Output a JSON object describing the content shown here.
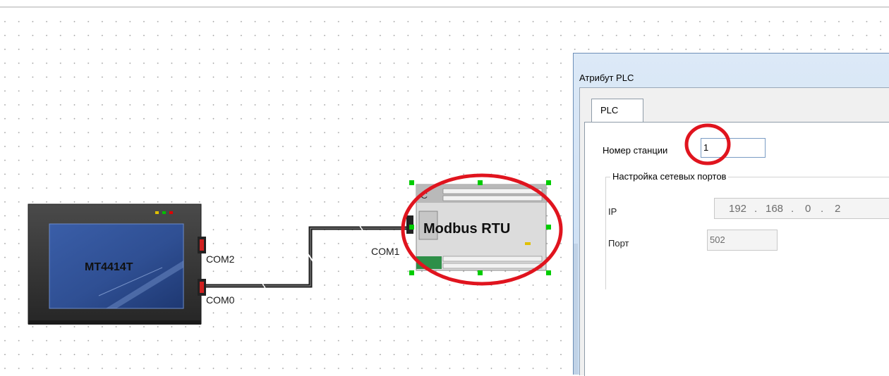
{
  "canvas": {
    "hmi_label": "MT4414T",
    "hmi_ports": [
      "COM2",
      "COM0"
    ],
    "plc_label": "Modbus RTU",
    "plc_port": "COM1"
  },
  "dialog": {
    "title": "Атрибут PLC",
    "tab": "PLC",
    "station_label": "Номер станции",
    "station_value": "1",
    "network_group": "Настройка сетевых портов",
    "ip_label": "IP",
    "ip_octets": [
      "192",
      "168",
      "0",
      "2"
    ],
    "port_label": "Порт",
    "port_value": "502"
  },
  "colors": {
    "annotation": "#e0141e",
    "dialog_border": "#6d8fb8",
    "handle": "#00cc00"
  }
}
